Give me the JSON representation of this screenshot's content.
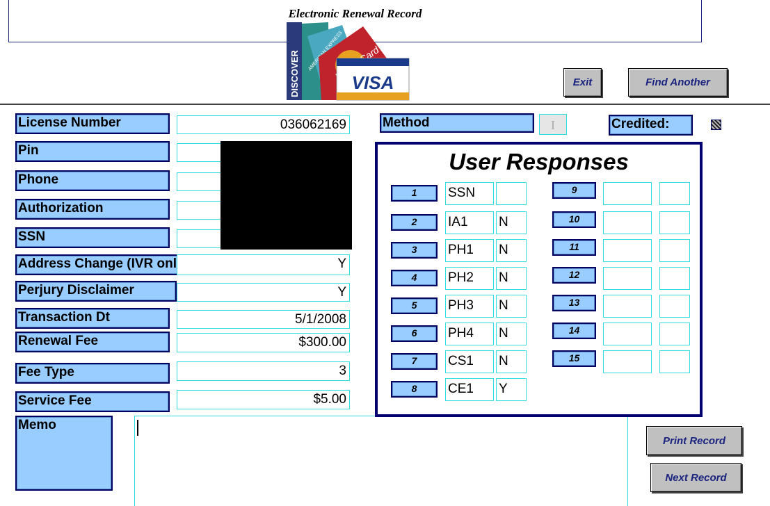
{
  "title": "Electronic Renewal Record",
  "cards_logo": {
    "discover": "DISCOVER",
    "amex": "AMERICAN EXPRESS",
    "mastercard": "MasterCard",
    "visa": "VISA"
  },
  "buttons": {
    "exit": "Exit",
    "find_another": "Find Another",
    "print_record": "Print Record",
    "next_record": "Next Record"
  },
  "fields": [
    {
      "label": "License Number",
      "value": "036062169"
    },
    {
      "label": "Pin",
      "value": ""
    },
    {
      "label": "Phone",
      "value": ""
    },
    {
      "label": "Authorization",
      "value": ""
    },
    {
      "label": "SSN",
      "value": ""
    },
    {
      "label": "Address Change (IVR only)",
      "value": "Y"
    },
    {
      "label": "Perjury Disclaimer",
      "value": "Y"
    },
    {
      "label": "Transaction Dt",
      "value": "5/1/2008"
    },
    {
      "label": "Renewal Fee",
      "value": "$300.00"
    },
    {
      "label": "Fee Type",
      "value": "3"
    },
    {
      "label": "Service Fee",
      "value": "$5.00"
    }
  ],
  "memo": {
    "label": "Memo",
    "value": ""
  },
  "method": {
    "label": "Method",
    "value": ""
  },
  "credited": {
    "label": "Credited:",
    "checked": true
  },
  "user_responses": {
    "title": "User Responses",
    "items": [
      {
        "num": "1",
        "code": "SSN",
        "value": ""
      },
      {
        "num": "2",
        "code": "IA1",
        "value": "N"
      },
      {
        "num": "3",
        "code": "PH1",
        "value": "N"
      },
      {
        "num": "4",
        "code": "PH2",
        "value": "N"
      },
      {
        "num": "5",
        "code": "PH3",
        "value": "N"
      },
      {
        "num": "6",
        "code": "PH4",
        "value": "N"
      },
      {
        "num": "7",
        "code": "CS1",
        "value": "N"
      },
      {
        "num": "8",
        "code": "CE1",
        "value": "Y"
      },
      {
        "num": "9",
        "code": "",
        "value": ""
      },
      {
        "num": "10",
        "code": "",
        "value": ""
      },
      {
        "num": "11",
        "code": "",
        "value": ""
      },
      {
        "num": "12",
        "code": "",
        "value": ""
      },
      {
        "num": "13",
        "code": "",
        "value": ""
      },
      {
        "num": "14",
        "code": "",
        "value": ""
      },
      {
        "num": "15",
        "code": "",
        "value": ""
      }
    ]
  }
}
